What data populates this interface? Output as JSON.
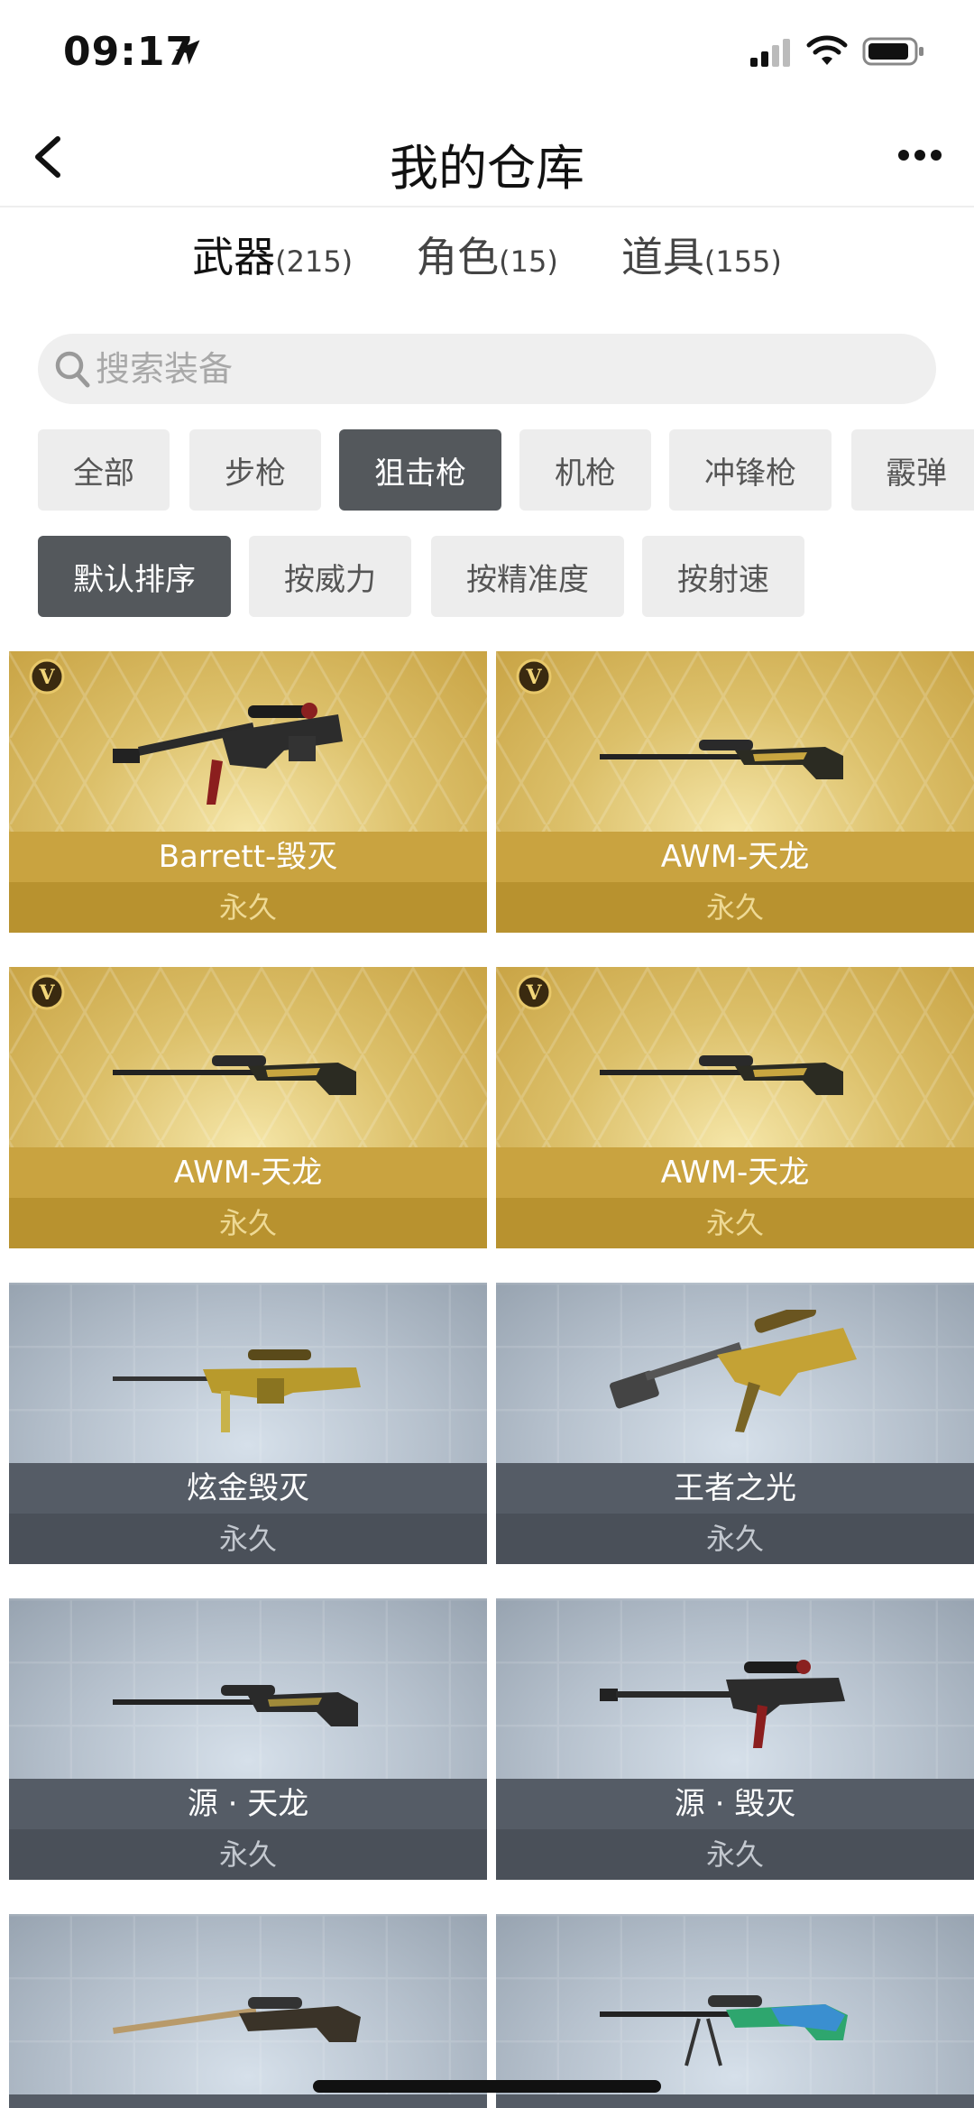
{
  "status_bar": {
    "time": "09:17"
  },
  "nav": {
    "title": "我的仓库"
  },
  "tabs": [
    {
      "label": "武器",
      "count": "(215)"
    },
    {
      "label": "角色",
      "count": "(15)"
    },
    {
      "label": "道具",
      "count": "(155)"
    }
  ],
  "search": {
    "placeholder": "搜索装备"
  },
  "categories": [
    {
      "label": "全部",
      "active": false
    },
    {
      "label": "步枪",
      "active": false
    },
    {
      "label": "狙击枪",
      "active": true
    },
    {
      "label": "机枪",
      "active": false
    },
    {
      "label": "冲锋枪",
      "active": false
    },
    {
      "label": "霰弹",
      "active": false
    }
  ],
  "sort_options": [
    {
      "label": "默认排序",
      "active": true
    },
    {
      "label": "按威力",
      "active": false
    },
    {
      "label": "按精准度",
      "active": false
    },
    {
      "label": "按射速",
      "active": false
    }
  ],
  "items": [
    {
      "name": "Barrett-毁灭",
      "duration": "永久",
      "tier": "gold",
      "vip": true
    },
    {
      "name": "AWM-天龙",
      "duration": "永久",
      "tier": "gold",
      "vip": true
    },
    {
      "name": "AWM-天龙",
      "duration": "永久",
      "tier": "gold",
      "vip": true
    },
    {
      "name": "AWM-天龙",
      "duration": "永久",
      "tier": "gold",
      "vip": true
    },
    {
      "name": "炫金毁灭",
      "duration": "永久",
      "tier": "silver",
      "vip": false
    },
    {
      "name": "王者之光",
      "duration": "永久",
      "tier": "silver",
      "vip": false
    },
    {
      "name": "源 · 天龙",
      "duration": "永久",
      "tier": "silver",
      "vip": false
    },
    {
      "name": "源 · 毁灭",
      "duration": "永久",
      "tier": "silver",
      "vip": false
    },
    {
      "name": "",
      "duration": "",
      "tier": "silver",
      "vip": false
    },
    {
      "name": "",
      "duration": "",
      "tier": "silver",
      "vip": false
    }
  ],
  "colors": {
    "accent_dark": "#54585c",
    "gold": "#c9a340",
    "silver": "#555c66"
  }
}
